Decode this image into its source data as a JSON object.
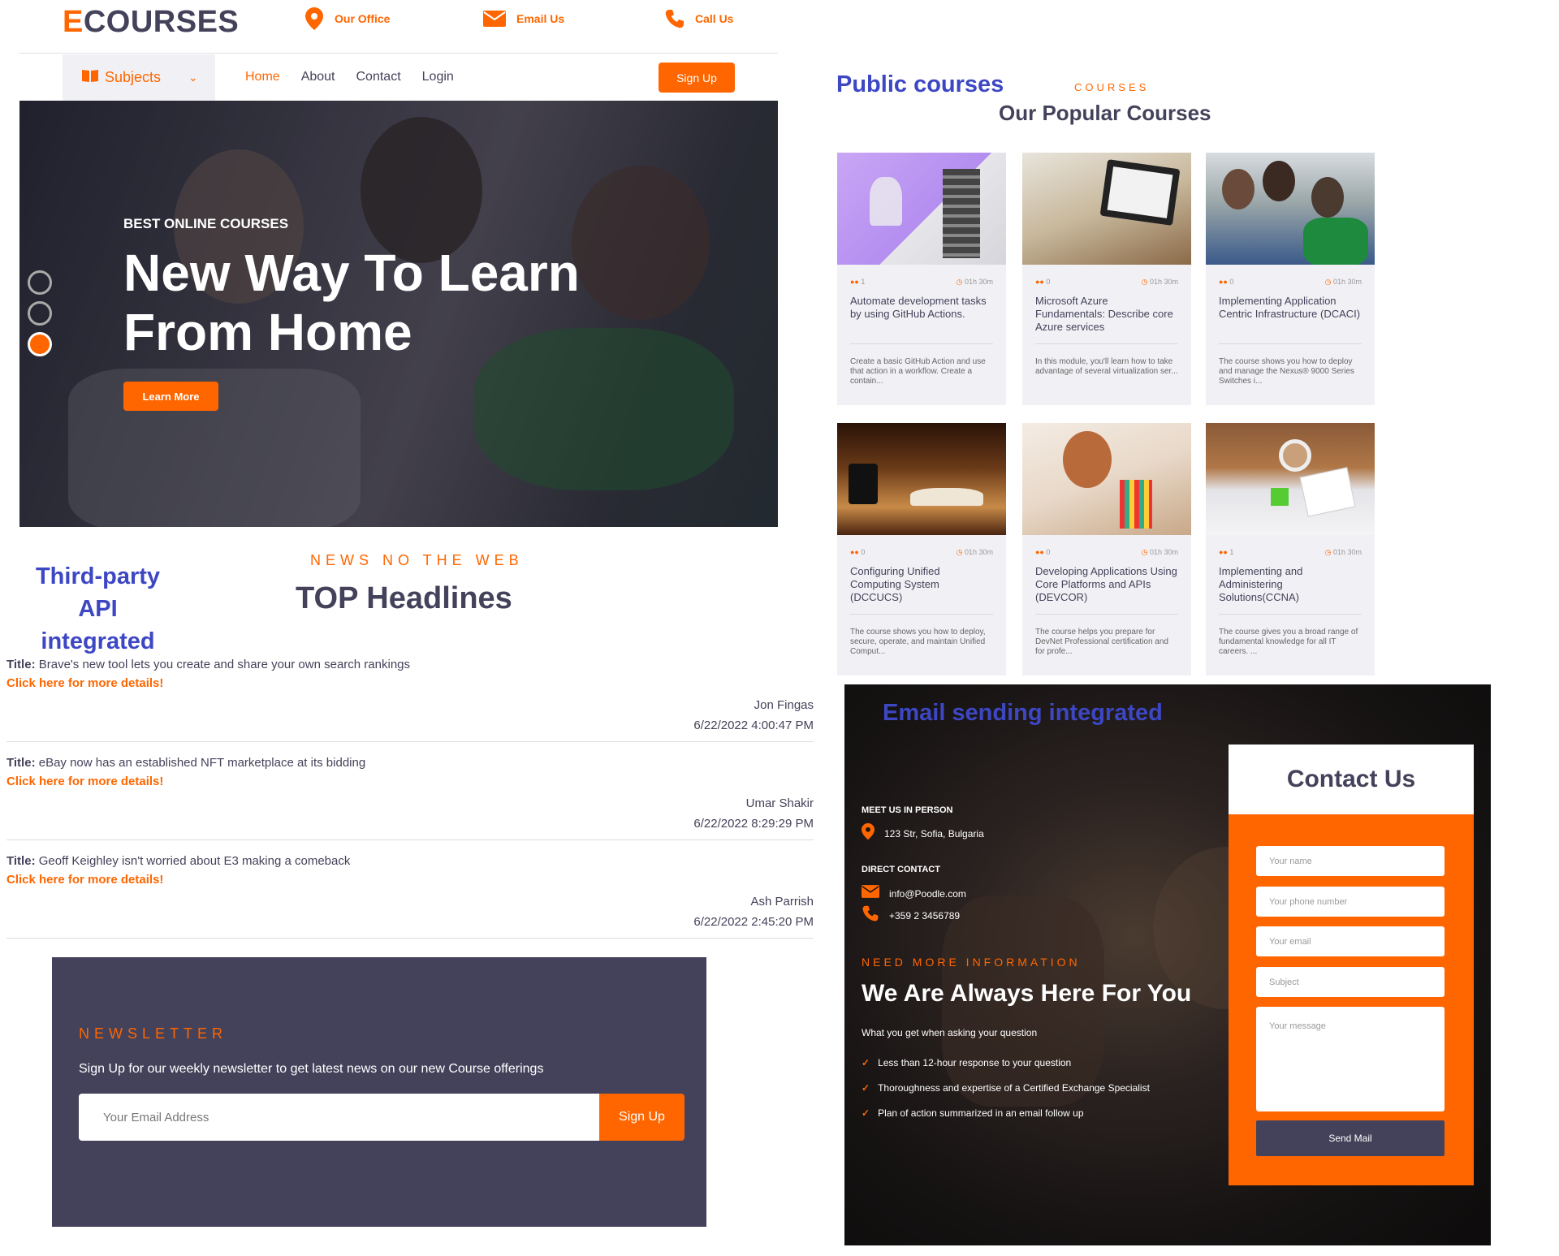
{
  "header": {
    "logo_first": "E",
    "logo_rest": "COURSES",
    "office": "Our Office",
    "email": "Email Us",
    "call": "Call Us"
  },
  "nav": {
    "subjects": "Subjects",
    "items": [
      "Home",
      "About",
      "Contact",
      "Login"
    ],
    "signup": "Sign Up"
  },
  "hero": {
    "eyebrow": "BEST ONLINE COURSES",
    "title_line1": "New Way To Learn",
    "title_line2": "From Home",
    "button": "Learn More"
  },
  "news_section": {
    "annotation_line1": "Third-party API",
    "annotation_line2": "integrated",
    "eyebrow": "NEWS NO THE WEB",
    "title": "TOP Headlines",
    "title_label": "Title:",
    "items": [
      {
        "title": "Brave's new tool lets you create and share your own search rankings",
        "link": "Click here for more details!",
        "author": "Jon Fingas",
        "date": "6/22/2022 4:00:47 PM"
      },
      {
        "title": "eBay now has an established NFT marketplace at its bidding",
        "link": "Click here for more details!",
        "author": "Umar Shakir",
        "date": "6/22/2022 8:29:29 PM"
      },
      {
        "title": "Geoff Keighley isn't worried about E3 making a comeback",
        "link": "Click here for more details!",
        "author": "Ash Parrish",
        "date": "6/22/2022 2:45:20 PM"
      }
    ]
  },
  "newsletter": {
    "eyebrow": "NEWSLETTER",
    "text": "Sign Up for our weekly newsletter to get latest news on our new Course offerings",
    "placeholder": "Your Email Address",
    "button": "Sign Up"
  },
  "courses_section": {
    "annotation": "Public courses",
    "eyebrow": "COURSES",
    "title": "Our Popular Courses",
    "courses": [
      {
        "students": "1",
        "duration": "01h 30m",
        "title": "Automate development tasks by using GitHub Actions.",
        "desc": "Create a basic GitHub Action and use that action in a workflow. Create a contain..."
      },
      {
        "students": "0",
        "duration": "01h 30m",
        "title": "Microsoft Azure Fundamentals: Describe core Azure services",
        "desc": "In this module, you'll learn how to take advantage of several virtualization ser..."
      },
      {
        "students": "0",
        "duration": "01h 30m",
        "title": "Implementing Application Centric Infrastructure (DCACI)",
        "desc": "The course shows you how to deploy and manage the Nexus® 9000 Series Switches i..."
      },
      {
        "students": "0",
        "duration": "01h 30m",
        "title": "Configuring Unified Computing System (DCCUCS)",
        "desc": "The course shows you how to deploy, secure, operate, and maintain Unified Comput..."
      },
      {
        "students": "0",
        "duration": "01h 30m",
        "title": "Developing Applications Using Core Platforms and APIs (DEVCOR)",
        "desc": "The course helps you prepare for DevNet Professional certification and for profe..."
      },
      {
        "students": "1",
        "duration": "01h 30m",
        "title": "Implementing and Administering Solutions(CCNA)",
        "desc": "The course gives you a broad range of fundamental knowledge for all IT careers. ..."
      }
    ]
  },
  "contact_section": {
    "annotation": "Email sending  integrated",
    "meet_label": "MEET US IN PERSON",
    "address": "123 Str, Sofia, Bulgaria",
    "direct_label": "DIRECT CONTACT",
    "email": "info@Poodle.com",
    "phone": "+359 2 3456789",
    "eyebrow": "NEED MORE INFORMATION",
    "title": "We Are Always Here For You",
    "subtitle": "What you get when asking your question",
    "benefits": [
      "Less than 12-hour response to your question",
      "Thoroughness and expertise of a Certified Exchange Specialist",
      "Plan of action summarized in an email follow up"
    ],
    "form_title": "Contact Us",
    "name_placeholder": "Your name",
    "phone_placeholder": "Your phone number",
    "email_placeholder": "Your email",
    "subject_placeholder": "Subject",
    "message_placeholder": "Your message",
    "send_button": "Send Mail"
  },
  "colors": {
    "accent": "#ff6600",
    "dark": "#44425a",
    "annotation": "#3d47c4"
  }
}
